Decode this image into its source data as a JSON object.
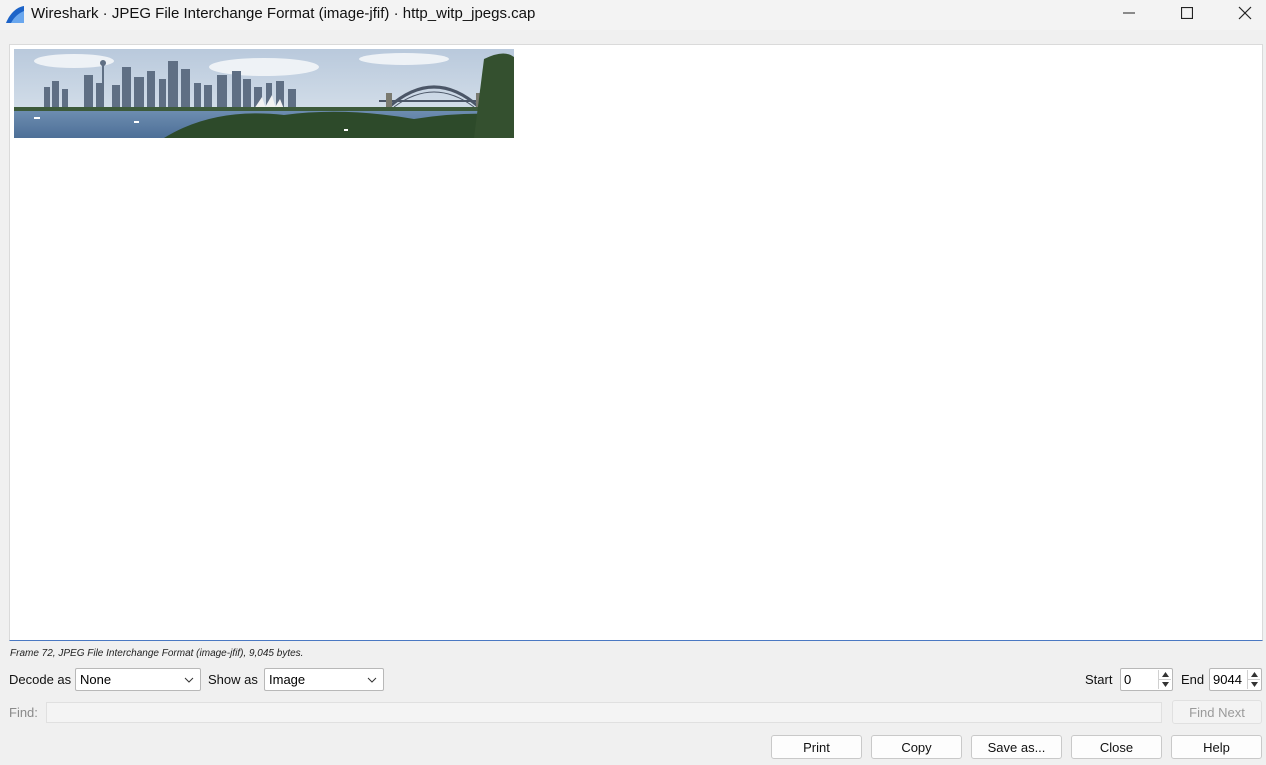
{
  "window": {
    "title": "Wireshark · JPEG File Interchange Format (image-jfif) · http_witp_jpegs.cap",
    "icons": {
      "app": "wireshark-fin-icon",
      "minimize": "minimize-icon",
      "maximize": "maximize-icon",
      "close": "close-icon"
    }
  },
  "viewer": {
    "image_description_icon": "sydney-harbour-photo"
  },
  "status": {
    "text": "Frame 72, JPEG File Interchange Format (image-jfif), 9,045 bytes."
  },
  "controls": {
    "decode_label": "Decode as",
    "decode_value": "None",
    "show_label": "Show as",
    "show_value": "Image",
    "start_label": "Start",
    "start_value": "0",
    "end_label": "End",
    "end_value": "9044"
  },
  "find": {
    "label": "Find:",
    "value": "",
    "find_next_label": "Find Next"
  },
  "buttons": {
    "print": "Print",
    "copy": "Copy",
    "save_as": "Save as...",
    "close": "Close",
    "help": "Help"
  },
  "colors": {
    "accent": "#4a78c2",
    "wireshark_blue": "#1c63c8"
  }
}
